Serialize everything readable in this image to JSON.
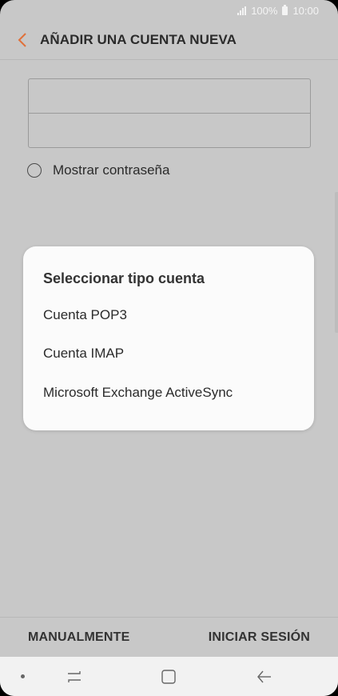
{
  "status_bar": {
    "battery_text": "100%",
    "time": "10:00"
  },
  "header": {
    "title": "AÑADIR UNA CUENTA NUEVA",
    "back_icon": "chevron-left-icon",
    "accent_color": "#e0703a"
  },
  "form": {
    "email_value": "",
    "password_value": "",
    "show_password_label": "Mostrar contraseña",
    "show_password_checked": false
  },
  "dialog": {
    "title": "Seleccionar tipo cuenta",
    "options": [
      {
        "label": "Cuenta POP3"
      },
      {
        "label": "Cuenta IMAP"
      },
      {
        "label": "Microsoft Exchange ActiveSync"
      }
    ]
  },
  "actions": {
    "manual_label": "MANUALMENTE",
    "signin_label": "INICIAR SESIÓN"
  },
  "nav_bar": {
    "icons": [
      "dot-indicator",
      "recent-apps-icon",
      "home-icon",
      "back-icon"
    ]
  }
}
